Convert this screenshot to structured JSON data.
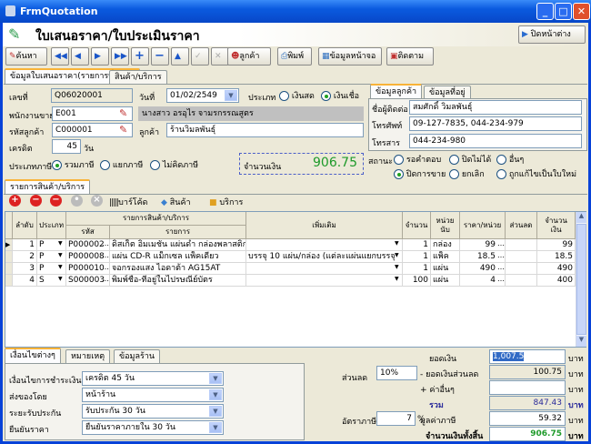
{
  "window": {
    "title": "FrmQuotation"
  },
  "header": {
    "title": "ใบเสนอราคา/ใบประเมินราคา",
    "close_label": "ปิดหน้าต่าง"
  },
  "toolbar": {
    "search": "ค้นหา",
    "customer": "ลูกค้า",
    "print": "พิมพ์",
    "screen_info": "ข้อมูลหน้าจอ",
    "follow": "ติดตาม"
  },
  "tabs": [
    "ข้อมูลใบเสนอราคา(รายการที่เลือก)",
    "สินค้า/บริการ"
  ],
  "form": {
    "doc_no_label": "เลขที่",
    "doc_no": "Q06020001",
    "date_label": "วันที่",
    "date": "01/02/2549",
    "type_label": "ประเภท",
    "type_options": [
      "เงินสด",
      "เงินเชื่อ"
    ],
    "salesman_label": "พนักงานขาย",
    "salesman_code": "E001",
    "salesman_name": "นางสาว อรอุไร จามรกรรณสูตร",
    "customer_code_label": "รหัสลูกค้า",
    "customer_code": "C000001",
    "customer_label": "ลูกค้า",
    "customer_name": "ร้านวิมลพันธุ์",
    "credit_label": "เครดิต",
    "credit": "45",
    "credit_unit": "วัน",
    "tax_type_label": "ประเภทภาษี",
    "tax_options": [
      "รวมภาษี",
      "แยกภาษี",
      "ไม่คิดภาษี"
    ],
    "amount_label": "จำนวนเงิน",
    "amount": "906.75"
  },
  "contact": {
    "tabs": [
      "ข้อมูลลูกค้า",
      "ข้อมูลที่อยู่"
    ],
    "contact_label": "ชื่อผู้ติดต่อ",
    "contact_name": "สมศักดิ์ วิมลพันธุ์",
    "phone_label": "โทรศัพท์",
    "phone": "09-127-7835, 044-234-979",
    "fax_label": "โทรสาร",
    "fax": "044-234-980"
  },
  "status": {
    "label": "สถานะ",
    "options": [
      "รอคำตอบ",
      "ปิดไม่ได้",
      "อื่นๆ",
      "ปิดการขาย",
      "ยกเลิก",
      "ถูกแก้ไขเป็นใบใหม่"
    ]
  },
  "items": {
    "tab": "รายการสินค้า/บริการ",
    "barcode": "บาร์โค้ด",
    "product": "สินค้า",
    "service": "บริการ",
    "headers": {
      "no": "ลำดับ",
      "type": "ประเภท",
      "group": "รายการสินค้า/บริการ",
      "code": "รหัส",
      "desc": "รายการ",
      "extra": "เพิ่มเติม",
      "qty": "จำนวน",
      "unit": "หน่วยนับ",
      "price": "ราคา/หน่วย",
      "discount": "ส่วนลด",
      "total": "จำนวนเงิน"
    },
    "rows": [
      {
        "no": "1",
        "type": "P",
        "code": "P000002",
        "desc": "ดิสเก็ต อิมเมชั่น แผ่นดำ กล่องพลาสติก",
        "extra": "",
        "qty": "1",
        "unit": "กล่อง",
        "price": "99",
        "discount": "",
        "total": "99"
      },
      {
        "no": "2",
        "type": "P",
        "code": "P000008",
        "desc": "แผ่น CD-R แม็กเซล แพ็คเดี่ยว",
        "extra": "บรรจุ 10 แผ่น/กล่อง (แต่ละแผ่นแยกบรรจุ",
        "qty": "1",
        "unit": "แพ็ค",
        "price": "18.5",
        "discount": "",
        "total": "18.5"
      },
      {
        "no": "3",
        "type": "P",
        "code": "P000010",
        "desc": "จอกรองแสง ไอดาต้า AG15AT",
        "extra": "",
        "qty": "1",
        "unit": "แผ่น",
        "price": "490",
        "discount": "",
        "total": "490"
      },
      {
        "no": "4",
        "type": "S",
        "code": "S000003",
        "desc": "พิมพ์ชื่อ-ที่อยู่ในไปรษณีย์บัตร",
        "extra": "",
        "qty": "100",
        "unit": "แผ่น",
        "price": "4",
        "discount": "",
        "total": "400"
      }
    ]
  },
  "bottom_tabs": [
    "เงื่อนไขต่างๆ",
    "หมายเหตุ",
    "ข้อมูลร้าน"
  ],
  "conditions": [
    {
      "label": "เงื่อนไขการชำระเงิน",
      "value": "เครดิต 45 วัน"
    },
    {
      "label": "ส่งของโดย",
      "value": "หน้าร้าน"
    },
    {
      "label": "ระยะรับประกัน",
      "value": "รับประกัน 30 วัน"
    },
    {
      "label": "ยืนยันราคา",
      "value": "ยืนยันราคาภายใน 30 วัน"
    }
  ],
  "totals": {
    "discount_label": "ส่วนลด",
    "discount": "10%",
    "vat_rate_label": "อัตราภาษี",
    "vat_rate": "7",
    "pct": "%",
    "subtotal_label": "ยอดเงิน",
    "subtotal": "1,007.5",
    "disc_amount_label": "- ยอดเงินส่วนลด",
    "disc_amount": "100.75",
    "other_label": "+ ค่าอื่นๆ",
    "other": "",
    "sum_label": "รวม",
    "sum": "847.43",
    "vat_label": "มูลค่าภาษี",
    "vat": "59.32",
    "grand_label": "จำนวนเงินทั้งสิ้น",
    "grand": "906.75",
    "currency": "บาท"
  }
}
